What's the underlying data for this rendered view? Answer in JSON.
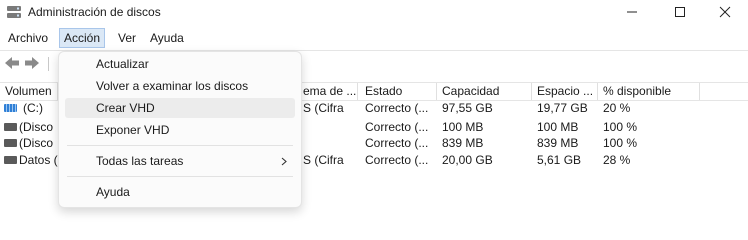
{
  "window": {
    "title": "Administración de discos"
  },
  "menu": {
    "items": [
      "Archivo",
      "Acción",
      "Ver",
      "Ayuda"
    ],
    "active": "Acción"
  },
  "columns": [
    "Volumen",
    "",
    "ema de ...",
    "Estado",
    "Capacidad",
    "Espacio ...",
    "% disponible"
  ],
  "rows": [
    {
      "volume": "(C:)",
      "fs": "S (Cifra",
      "status": "Correcto (...",
      "capacity": "97,55 GB",
      "free": "19,77 GB",
      "pct": "20 %",
      "icon": "drive-striped-icon"
    },
    {
      "volume": "(Disco",
      "fs": "",
      "status": "Correcto (...",
      "capacity": "100 MB",
      "free": "100 MB",
      "pct": "100 %",
      "icon": "drive-icon"
    },
    {
      "volume": "(Disco",
      "fs": "",
      "status": "Correcto (...",
      "capacity": "839 MB",
      "free": "839 MB",
      "pct": "100 %",
      "icon": "drive-icon"
    },
    {
      "volume": "Datos (",
      "fs": "S (Cifra",
      "status": "Correcto (...",
      "capacity": "20,00 GB",
      "free": "5,61 GB",
      "pct": "28 %",
      "icon": "drive-icon"
    }
  ],
  "context_menu": {
    "items": {
      "actualizar": "Actualizar",
      "volver": "Volver a examinar los discos",
      "crear_vhd": "Crear VHD",
      "exponer_vhd": "Exponer VHD",
      "todas_tareas": "Todas las tareas",
      "ayuda": "Ayuda"
    },
    "submenu_arrow": ">",
    "hovered": "Crear VHD"
  },
  "colors": {
    "menu_active_bg": "#dbe8f6",
    "menu_hover_bg": "#ececec",
    "drive_c": "#2f7fd6",
    "drive": "#5a5a5a"
  }
}
